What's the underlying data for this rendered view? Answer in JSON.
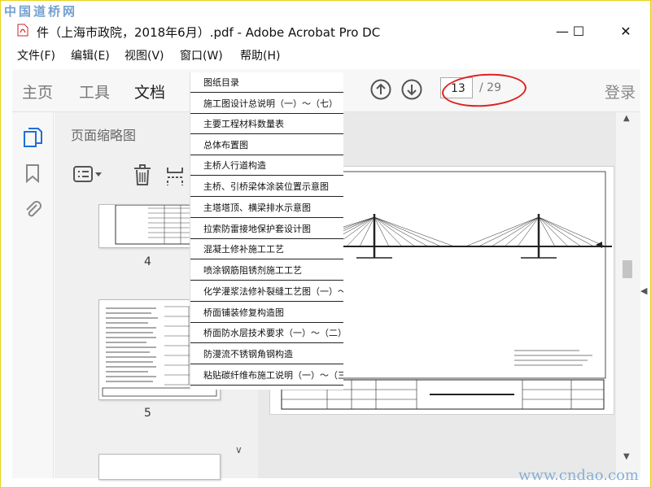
{
  "watermark": {
    "top": "中国道桥网",
    "bottom": "www.cndao.com"
  },
  "window": {
    "title": "件（上海市政院，2018年6月）.pdf - Adobe Acrobat Pro DC",
    "controls": {
      "minimize": "—",
      "maximize": "☐",
      "close": "✕"
    }
  },
  "menu": [
    "文件(F)",
    "编辑(E)",
    "视图(V)",
    "窗口(W)",
    "帮助(H)"
  ],
  "toolbar": {
    "tabs": [
      "主页",
      "工具",
      "文档"
    ],
    "active_tab": "文档",
    "page_current": "13",
    "page_total": "/ 29",
    "login": "登录"
  },
  "thumbnails": {
    "title": "页面缩略图",
    "pages": [
      {
        "label": "4"
      },
      {
        "label": "5"
      }
    ]
  },
  "bookmarks": [
    "图纸目录",
    "施工图设计总说明（一）～（七）",
    "主要工程材料数量表",
    "总体布置图",
    "主桥人行道构造",
    "主桥、引桥梁体涂装位置示意图",
    "主塔塔顶、横梁排水示意图",
    "拉索防雷接地保护套设计图",
    "混凝土修补施工工艺",
    "喷涂钢筋阻锈剂施工工艺",
    "化学灌浆法修补裂缝工艺图（一）～（二）",
    "桥面铺装修复构造图",
    "桥面防水层技术要求（一）～（二）",
    "防漫流不锈钢角钢构造",
    "粘贴碳纤维布施工说明（一）～（三）"
  ],
  "colors": {
    "accent": "#1f6fd6",
    "annotation": "#e02020",
    "watermark": "#5a8fc9"
  }
}
